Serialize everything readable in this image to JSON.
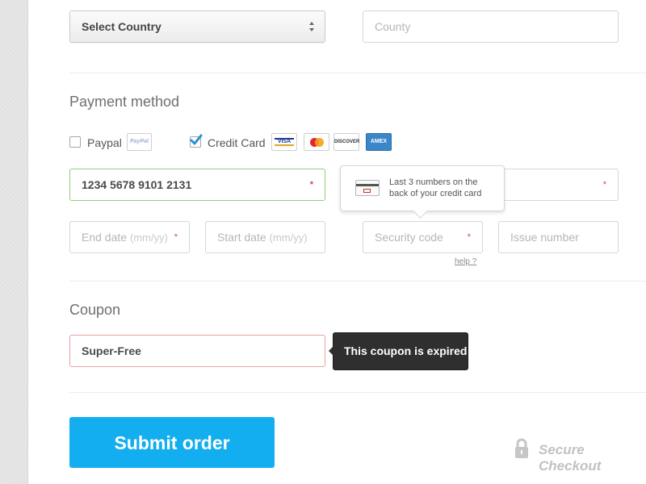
{
  "address": {
    "country_select_label": "Select Country",
    "county_placeholder": "County"
  },
  "payment": {
    "title": "Payment method",
    "paypal_label": "Paypal",
    "paypal_badge": "PayPal",
    "paypal_checked": false,
    "credit_card_label": "Credit Card",
    "credit_card_checked": true,
    "cards": [
      "VISA",
      "MC",
      "DISCOVER",
      "AMEX"
    ],
    "card_number_value": "1234 5678 9101 2131",
    "required_mark": "*",
    "end_date_placeholder": "End date",
    "end_date_hint": "(mm/yy)",
    "start_date_placeholder": "Start date",
    "start_date_hint": "(mm/yy)",
    "security_code_placeholder": "Security code",
    "issue_number_placeholder": "Issue number",
    "help_link": "help ?",
    "tooltip_line1": "Last 3 numbers on the",
    "tooltip_line2": "back of your credit card"
  },
  "coupon": {
    "title": "Coupon",
    "value": "Super-Free",
    "error_message": "This coupon is expired"
  },
  "actions": {
    "submit_label": "Submit order",
    "secure_label": "Secure Checkout"
  },
  "colors": {
    "accent": "#12aeef",
    "valid_border": "#8fcf7a",
    "error_border": "#e7a2a2",
    "required_star": "#d24b4b"
  }
}
